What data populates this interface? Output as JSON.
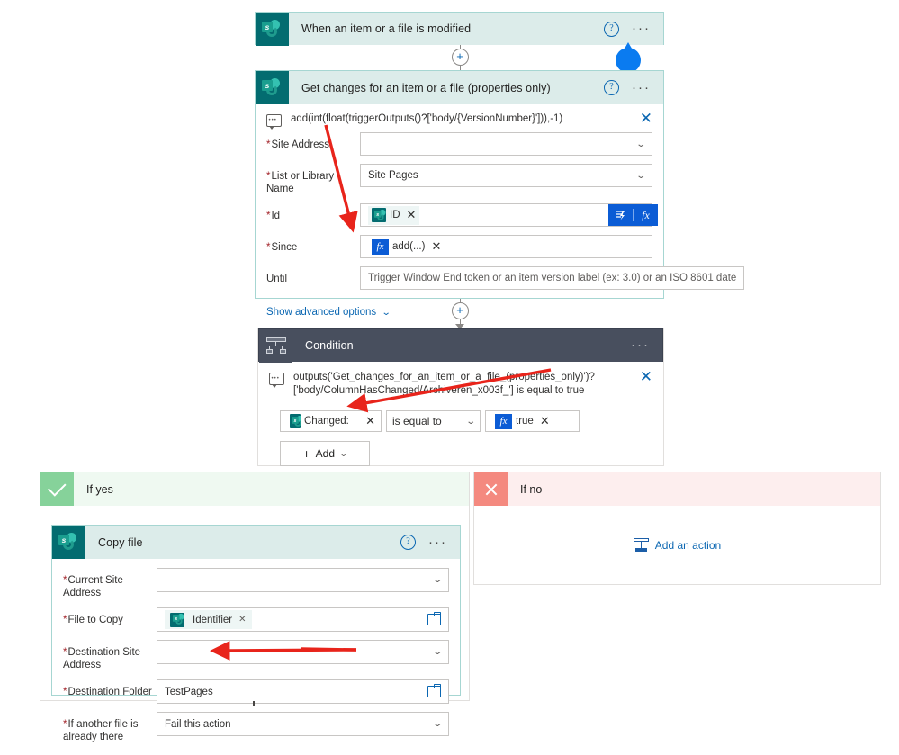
{
  "trigger_card": {
    "icon": "sharepoint-icon",
    "title": "When an item or a file is modified",
    "help_icon": "help-icon",
    "more_icon": "more-options-icon"
  },
  "action_card": {
    "icon": "sharepoint-icon",
    "title": "Get changes for an item or a file (properties only)",
    "help_icon": "help-icon",
    "more_icon": "more-options-icon",
    "comment": {
      "icon": "comment-icon",
      "text": "add(int(float(triggerOutputs()?['body/{VersionNumber}'])),-1)",
      "close_icon": "close-icon"
    },
    "fields": [
      {
        "label": "Site Address",
        "required": true,
        "type": "dropdown",
        "value": "",
        "placeholder": ""
      },
      {
        "label": "List or Library Name",
        "required": true,
        "type": "dropdown",
        "value": "Site Pages",
        "placeholder": ""
      },
      {
        "label": "Id",
        "required": true,
        "type": "token-sp",
        "value": "ID",
        "placeholder": ""
      },
      {
        "label": "Since",
        "required": true,
        "type": "token-fx",
        "value": "add(...)",
        "placeholder": ""
      },
      {
        "label": "Until",
        "required": false,
        "type": "text",
        "value": "",
        "placeholder": "Trigger Window End token or an item version label (ex: 3.0) or an ISO 8601 date"
      }
    ],
    "id_buttons": {
      "dynamic_icon": "dynamic-content-icon",
      "fx_label": "fx"
    },
    "advanced_link": {
      "label": "Show advanced options",
      "chevron": "chevron-down-icon"
    }
  },
  "condition_card": {
    "icon": "condition-icon",
    "title": "Condition",
    "more_icon": "more-options-icon",
    "comment": {
      "icon": "comment-icon",
      "text": "outputs('Get_changes_for_an_item_or_a_file_(properties_only)')?['body/ColumnHasChanged/Archiveren_x003f_'] is equal to true",
      "close_icon": "close-icon"
    },
    "row": {
      "left_token": {
        "icon": "sharepoint-icon",
        "label": "Changed:",
        "close_icon": "close-icon"
      },
      "operator": "is equal to",
      "operator_chevron": "chevron-down-icon",
      "right_token": {
        "icon": "fx-icon",
        "label": "true",
        "close_icon": "close-icon"
      }
    },
    "add_button": {
      "plus_icon": "plus-icon",
      "label": "Add",
      "chevron": "chevron-down-icon"
    }
  },
  "branch_yes": {
    "icon": "checkmark-icon",
    "label": "If yes",
    "copy_file_card": {
      "icon": "sharepoint-icon",
      "title": "Copy file",
      "help_icon": "help-icon",
      "more_icon": "more-options-icon",
      "fields": [
        {
          "label": "Current Site Address",
          "required": true,
          "type": "dropdown",
          "value": "",
          "placeholder": ""
        },
        {
          "label": "File to Copy",
          "required": true,
          "type": "token-file",
          "value": "Identifier",
          "placeholder": ""
        },
        {
          "label": "Destination Site Address",
          "required": true,
          "type": "dropdown",
          "value": "",
          "placeholder": ""
        },
        {
          "label": "Destination Folder",
          "required": true,
          "type": "folder",
          "value": "TestPages",
          "placeholder": ""
        },
        {
          "label": "If another file is already there",
          "required": true,
          "type": "dropdown",
          "value": "Fail this action",
          "placeholder": ""
        }
      ]
    }
  },
  "branch_no": {
    "icon": "close-icon",
    "label": "If no",
    "add_action": {
      "icon": "add-action-icon",
      "label": "Add an action"
    }
  },
  "connectors": [
    {
      "plus_icon": "add-step-icon"
    },
    {
      "plus_icon": "add-step-icon"
    }
  ],
  "annotations": {
    "comment_pin": "comment-pin",
    "arrow_since": "red-arrow",
    "arrow_condition": "red-arrow",
    "arrow_destination_folder": "red-arrow"
  },
  "colors": {
    "sharepoint_teal": "#036c70",
    "card_header_teal": "#dcecea",
    "condition_slate": "#484f5e",
    "yes_green": "#86d29a",
    "no_red": "#f4897f",
    "accent_blue": "#0b67b2",
    "token_blue": "#0b5cd5",
    "annotation_red": "#e8241b",
    "required_red": "#a4262c"
  }
}
